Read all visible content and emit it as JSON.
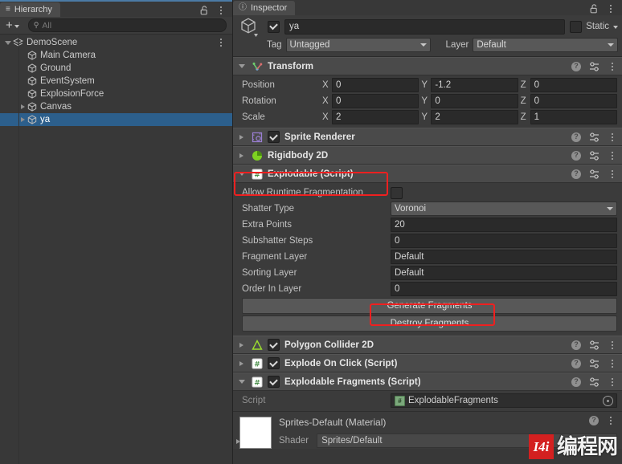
{
  "hierarchy": {
    "tab_label": "Hierarchy",
    "tab_icon": "hierarchy-icon",
    "lock_icon": "lock-open-icon",
    "menu_icon": "kebab-menu-icon",
    "add_label": "+",
    "search_placeholder": "All",
    "search_icon": "search-icon",
    "items": [
      {
        "label": "DemoScene",
        "depth": 0,
        "type": "scene",
        "expanded": true,
        "has_arrow": true,
        "selected": false,
        "has_menu": true
      },
      {
        "label": "Main Camera",
        "depth": 1,
        "type": "gameobject",
        "expanded": false,
        "has_arrow": false,
        "selected": false,
        "has_menu": false
      },
      {
        "label": "Ground",
        "depth": 1,
        "type": "gameobject",
        "expanded": false,
        "has_arrow": false,
        "selected": false,
        "has_menu": false
      },
      {
        "label": "EventSystem",
        "depth": 1,
        "type": "gameobject",
        "expanded": false,
        "has_arrow": false,
        "selected": false,
        "has_menu": false
      },
      {
        "label": "ExplosionForce",
        "depth": 1,
        "type": "gameobject",
        "expanded": false,
        "has_arrow": false,
        "selected": false,
        "has_menu": false
      },
      {
        "label": "Canvas",
        "depth": 1,
        "type": "gameobject",
        "expanded": false,
        "has_arrow": true,
        "selected": false,
        "has_menu": false
      },
      {
        "label": "ya",
        "depth": 1,
        "type": "gameobject",
        "expanded": false,
        "has_arrow": true,
        "selected": true,
        "has_menu": false
      }
    ]
  },
  "inspector": {
    "tab_label": "Inspector",
    "tab_icon": "info-icon",
    "lock_icon": "lock-open-icon",
    "menu_icon": "kebab-menu-icon",
    "object": {
      "enabled": true,
      "name": "ya",
      "static_label": "Static",
      "static_checked": false,
      "tag_label": "Tag",
      "tag_value": "Untagged",
      "layer_label": "Layer",
      "layer_value": "Default"
    },
    "transform": {
      "title": "Transform",
      "expanded": true,
      "rows": [
        {
          "label": "Position",
          "x": "0",
          "y": "-1.2",
          "z": "0"
        },
        {
          "label": "Rotation",
          "x": "0",
          "y": "0",
          "z": "0"
        },
        {
          "label": "Scale",
          "x": "2",
          "y": "2",
          "z": "1"
        }
      ],
      "axis_labels": [
        "X",
        "Y",
        "Z"
      ]
    },
    "components": [
      {
        "title": "Sprite Renderer",
        "icon": "sprite-renderer-icon",
        "has_checkbox": true,
        "checked": true,
        "expanded": false,
        "highlighted": false
      },
      {
        "title": "Rigidbody 2D",
        "icon": "rigidbody2d-icon",
        "has_checkbox": false,
        "checked": false,
        "expanded": false,
        "highlighted": false
      },
      {
        "title": "Explodable (Script)",
        "icon": "script-icon",
        "has_checkbox": false,
        "checked": false,
        "expanded": true,
        "highlighted": true
      },
      {
        "title": "Polygon Collider 2D",
        "icon": "polygon-collider-icon",
        "has_checkbox": true,
        "checked": true,
        "expanded": false,
        "highlighted": false
      },
      {
        "title": "Explode On Click (Script)",
        "icon": "script-icon",
        "has_checkbox": true,
        "checked": true,
        "expanded": false,
        "highlighted": false
      },
      {
        "title": "Explodable Fragments (Script)",
        "icon": "script-icon",
        "has_checkbox": true,
        "checked": true,
        "expanded": true,
        "highlighted": false
      }
    ],
    "explodable": {
      "allow_runtime_label": "Allow Runtime Fragmentation",
      "allow_runtime_checked": false,
      "shatter_type_label": "Shatter Type",
      "shatter_type_value": "Voronoi",
      "extra_points_label": "Extra Points",
      "extra_points_value": "20",
      "subshatter_label": "Subshatter Steps",
      "subshatter_value": "0",
      "fragment_layer_label": "Fragment Layer",
      "fragment_layer_value": "Default",
      "sorting_layer_label": "Sorting Layer",
      "sorting_layer_value": "Default",
      "order_in_layer_label": "Order In Layer",
      "order_in_layer_value": "0",
      "generate_button": "Generate Fragments",
      "destroy_button": "Destroy Fragments"
    },
    "explodable_fragments": {
      "script_label": "Script",
      "script_value": "ExplodableFragments",
      "selector_icon": "object-picker-icon"
    },
    "material": {
      "title": "Sprites-Default (Material)",
      "shader_label": "Shader",
      "shader_value": "Sprites/Default",
      "help_icon": "help-icon",
      "menu_icon": "kebab-menu-icon"
    },
    "row_icons": {
      "help": "help-icon",
      "preset": "preset-icon",
      "menu": "kebab-menu-icon"
    }
  },
  "annotations": {
    "highlight_color": "#ef2020",
    "boxes": [
      {
        "name": "explodable-script-highlight",
        "label": "Explodable (Script)"
      },
      {
        "name": "generate-fragments-highlight",
        "label": "Generate Fragments"
      }
    ]
  },
  "watermark": {
    "logo_text": "I4i",
    "text": "编程网"
  },
  "colors": {
    "panel_bg": "#383838",
    "component_header": "#4a4a4a",
    "field_bg": "#2a2a2a",
    "selection_blue": "#2c5f8c",
    "accent_red": "#ef2020"
  }
}
